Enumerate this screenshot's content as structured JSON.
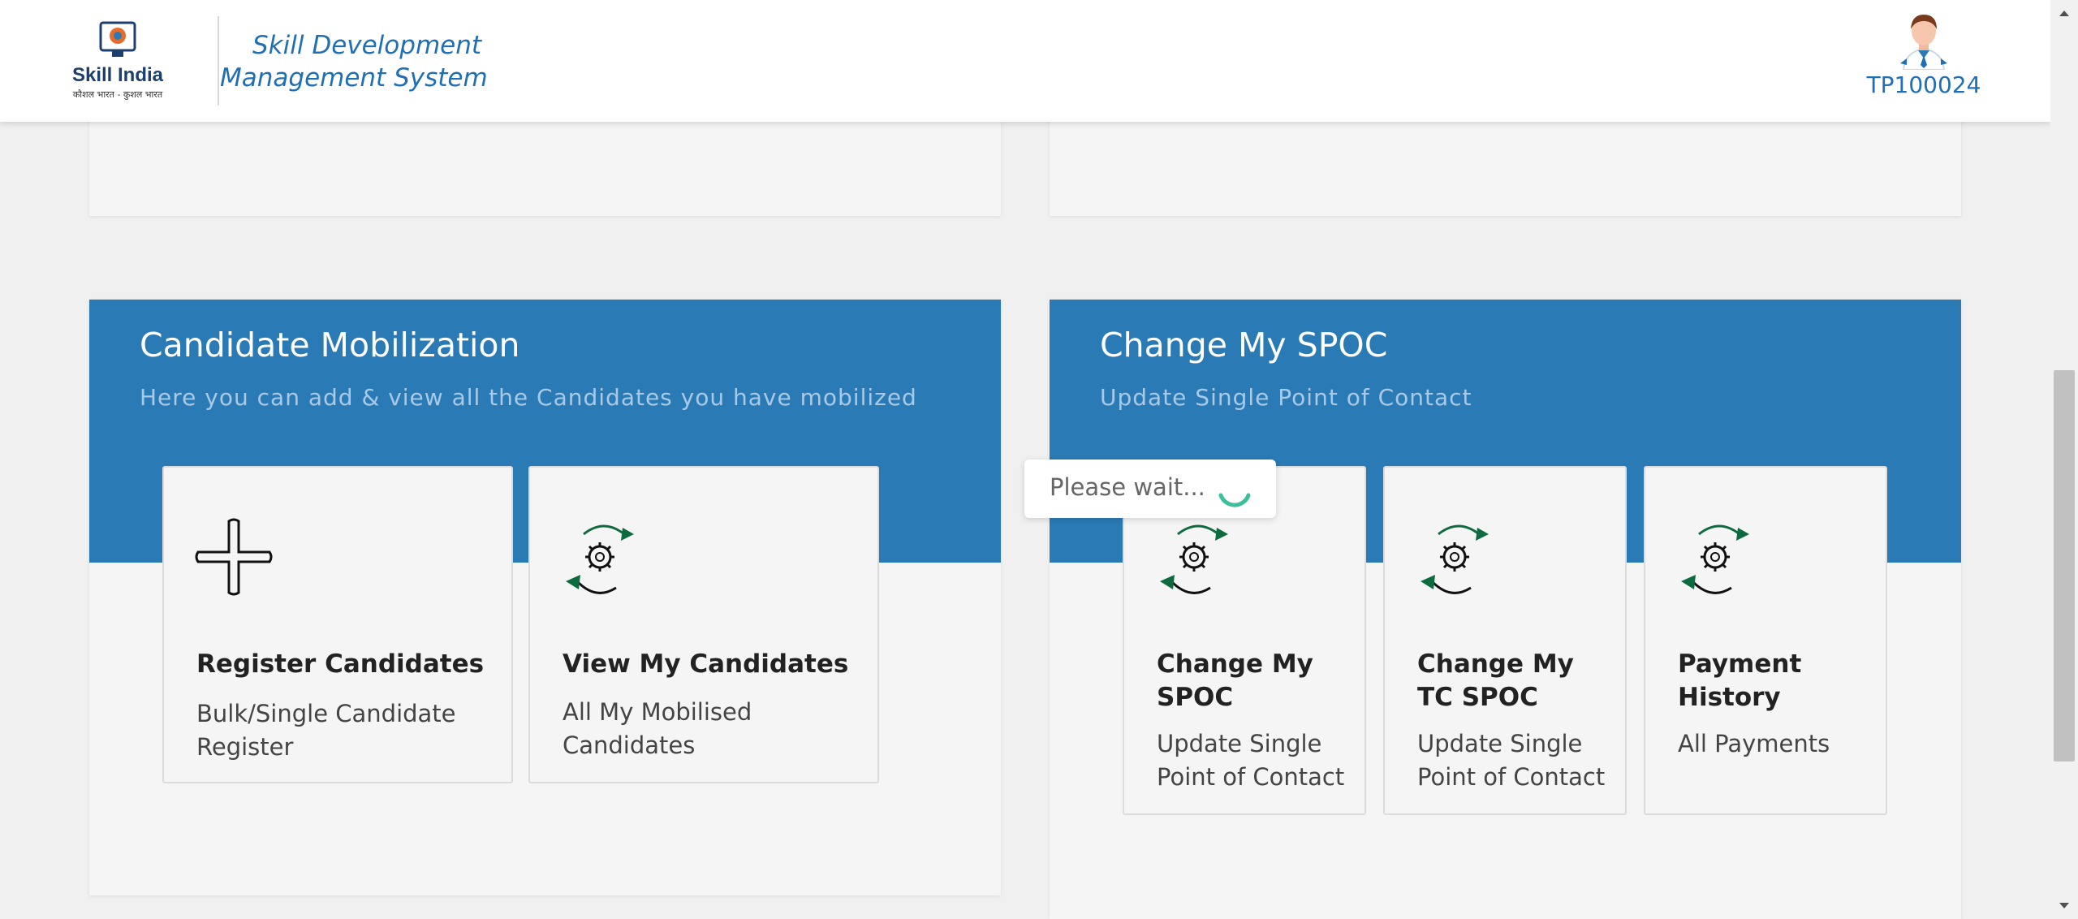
{
  "header": {
    "logo_text": "Skill India",
    "logo_tagline": "कौशल भारत - कुशल भारत",
    "app_title": "Skill Development Management System",
    "user_id": "TP100024"
  },
  "sections": {
    "mobilization": {
      "title": "Candidate Mobilization",
      "subtitle": "Here you can add & view all the Candidates you have mobilized",
      "tiles": [
        {
          "title": "Register Candidates",
          "desc": "Bulk/Single Candidate Register",
          "icon": "plus-icon"
        },
        {
          "title": "View My Candidates",
          "desc": "All My Mobilised Candidates",
          "icon": "gear-refresh-icon"
        }
      ]
    },
    "spoc": {
      "title": "Change My SPOC",
      "subtitle": "Update Single Point of Contact",
      "tiles": [
        {
          "title": "Change My SPOC",
          "desc": "Update Single Point of Contact",
          "icon": "gear-refresh-icon"
        },
        {
          "title": "Change My TC SPOC",
          "desc": "Update Single Point of Contact",
          "icon": "gear-refresh-icon"
        },
        {
          "title": "Payment History",
          "desc": "All Payments",
          "icon": "gear-refresh-icon"
        }
      ]
    }
  },
  "loading": {
    "text": "Please wait..."
  },
  "colors": {
    "brand_blue": "#2a7ab5",
    "link_blue": "#1f6fb4",
    "spinner_green": "#3cbf9b",
    "icon_green": "#0d6b3f"
  }
}
